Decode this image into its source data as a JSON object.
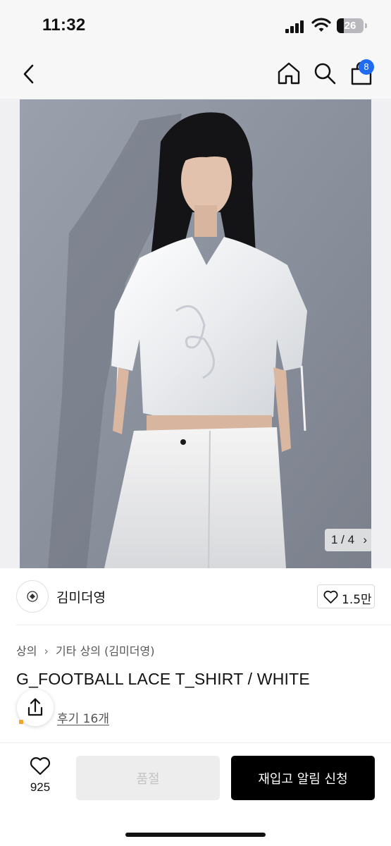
{
  "status_bar": {
    "time": "11:32",
    "battery_level": "26"
  },
  "nav": {
    "cart_count": "8"
  },
  "hero": {
    "image_counter": "1 / 4"
  },
  "brand": {
    "name": "김미더영",
    "likes": "1.5만"
  },
  "product": {
    "breadcrumb": [
      "상의",
      "기타 상의 (김미더영)"
    ],
    "title": "G_FOOTBALL LACE T_SHIRT / WHITE",
    "reviews": "후기 16개"
  },
  "bottom_bar": {
    "wishlist_count": "925",
    "soldout_label": "품절",
    "restock_label": "재입고 알림 신청"
  },
  "colors": {
    "badge": "#1f6cf2",
    "primary_button": "#000000",
    "disabled_button": "#ededed",
    "review_star": "#f4a628"
  },
  "icons": [
    "back-icon",
    "home-icon",
    "search-icon",
    "shopping-bag-icon",
    "heart-icon",
    "share-icon",
    "chevron-right-icon",
    "brand-logo-icon"
  ]
}
